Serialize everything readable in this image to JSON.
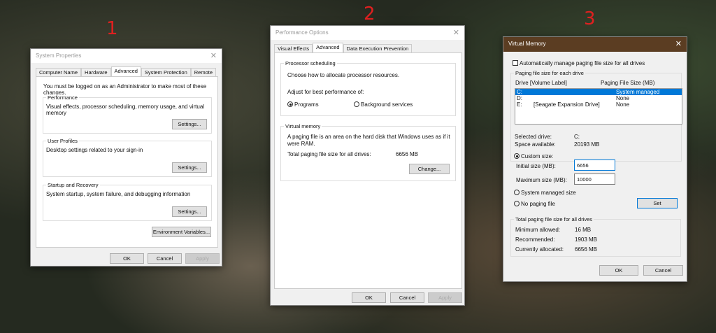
{
  "markers": [
    "1",
    "2",
    "3"
  ],
  "system_properties": {
    "title": "System Properties",
    "tabs": [
      "Computer Name",
      "Hardware",
      "Advanced",
      "System Protection",
      "Remote"
    ],
    "admin_note": "You must be logged on as an Administrator to make most of these changes.",
    "performance": {
      "label": "Performance",
      "desc": "Visual effects, processor scheduling, memory usage, and virtual memory",
      "button": "Settings..."
    },
    "user_profiles": {
      "label": "User Profiles",
      "desc": "Desktop settings related to your sign-in",
      "button": "Settings..."
    },
    "startup": {
      "label": "Startup and Recovery",
      "desc": "System startup, system failure, and debugging information",
      "button": "Settings..."
    },
    "env_button": "Environment Variables...",
    "ok": "OK",
    "cancel": "Cancel",
    "apply": "Apply"
  },
  "performance_options": {
    "title": "Performance Options",
    "tabs": [
      "Visual Effects",
      "Advanced",
      "Data Execution Prevention"
    ],
    "processor": {
      "label": "Processor scheduling",
      "desc": "Choose how to allocate processor resources.",
      "adjust": "Adjust for best performance of:",
      "opt1": "Programs",
      "opt2": "Background services",
      "selected": "Programs"
    },
    "virtual": {
      "label": "Virtual memory",
      "desc": "A paging file is an area on the hard disk that Windows uses as if it were RAM.",
      "total_label": "Total paging file size for all drives:",
      "total_value": "6656 MB",
      "button": "Change..."
    },
    "ok": "OK",
    "cancel": "Cancel",
    "apply": "Apply"
  },
  "virtual_memory": {
    "title": "Virtual Memory",
    "title_color": "#5b3d22",
    "auto_manage": "Automatically manage paging file size for all drives",
    "auto_checked": false,
    "group_label": "Paging file size for each drive",
    "col_drive": "Drive  [Volume Label]",
    "col_size": "Paging File Size (MB)",
    "drives": [
      {
        "drive": "C:",
        "label": "",
        "size": "System managed",
        "selected": true
      },
      {
        "drive": "D:",
        "label": "",
        "size": "None",
        "selected": false
      },
      {
        "drive": "E:",
        "label": "[Seagate Expansion Drive]",
        "size": "None",
        "selected": false
      }
    ],
    "selected_drive_label": "Selected drive:",
    "selected_drive": "C:",
    "space_label": "Space available:",
    "space": "20193 MB",
    "custom": "Custom size:",
    "initial_label": "Initial size (MB):",
    "initial": "6656",
    "max_label": "Maximum size (MB):",
    "max": "10000",
    "system_managed": "System managed size",
    "no_paging": "No paging file",
    "set": "Set",
    "total_group": "Total paging file size for all drives",
    "min_label": "Minimum allowed:",
    "min": "16 MB",
    "rec_label": "Recommended:",
    "rec": "1903 MB",
    "cur_label": "Currently allocated:",
    "cur": "6656 MB",
    "ok": "OK",
    "cancel": "Cancel"
  }
}
